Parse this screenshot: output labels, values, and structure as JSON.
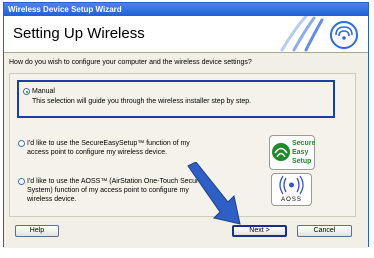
{
  "window": {
    "title": "Wireless Device Setup Wizard"
  },
  "header": {
    "title": "Setting Up Wireless"
  },
  "question": "How do you wish to configure your computer and the wireless device settings?",
  "options": [
    {
      "label": "Manual",
      "desc": "This selection will guide you through the wireless installer step by step.",
      "selected": true
    },
    {
      "line1": "I'd like to use the SecureEasySetup™ function of my",
      "line2": "access point to configure my wireless device.",
      "selected": false
    },
    {
      "line1": "I'd like to use the AOSS™ (AirStation One-Touch Secure",
      "line2": "System) function of my access point to configure my",
      "line3": "wireless device.",
      "selected": false
    }
  ],
  "logos": {
    "ses": {
      "line1": "Secure",
      "line2": "Easy",
      "line3": "Setup"
    },
    "aoss": {
      "text": "AOSS"
    }
  },
  "buttons": {
    "help": "Help",
    "next": "Next >",
    "cancel": "Cancel"
  },
  "colors": {
    "accent": "#1a3da8",
    "arrow": "#2f5fc4",
    "ses_green": "#1f8a2c"
  }
}
